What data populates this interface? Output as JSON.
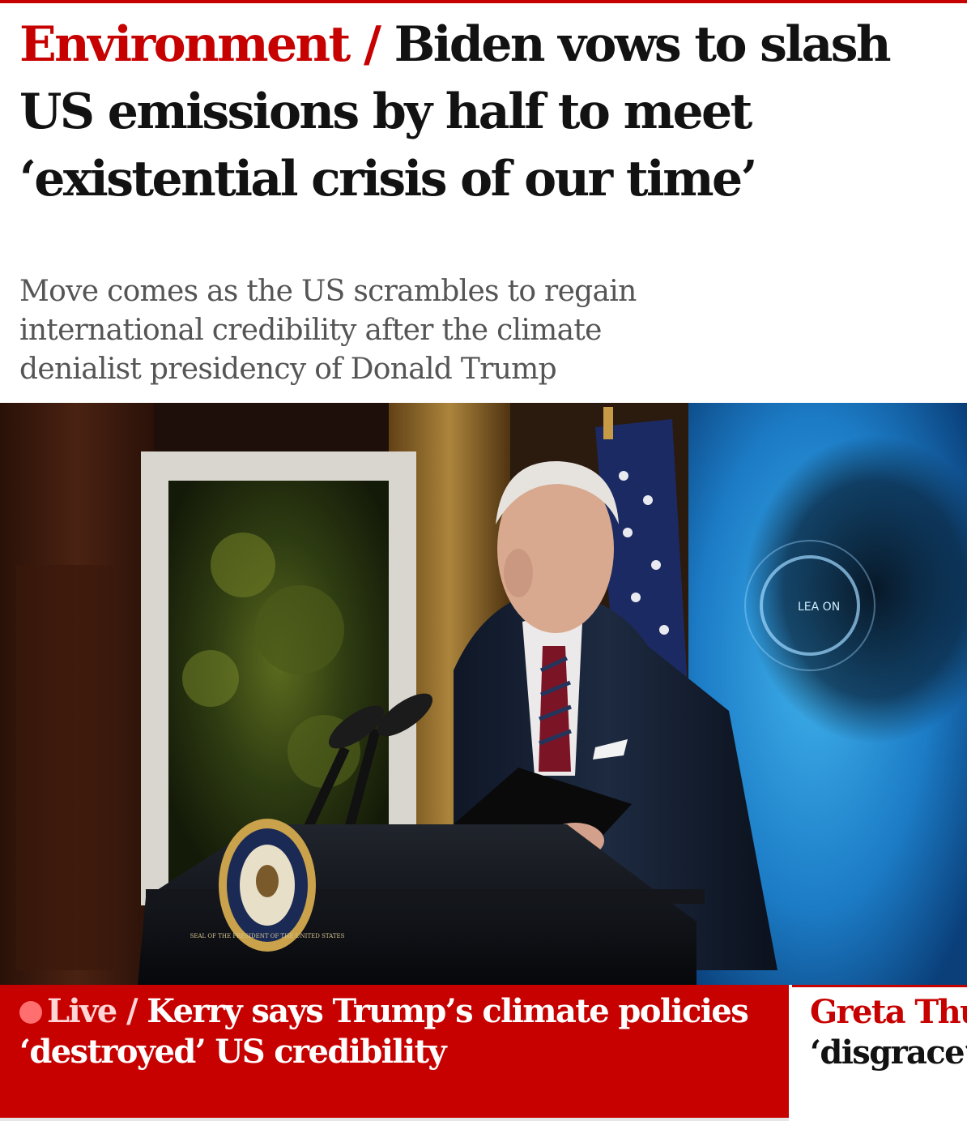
{
  "headline": {
    "kicker": "Environment",
    "separator": "/",
    "title": "Biden vows to slash US emissions by half to meet ‘existential crisis of our time’"
  },
  "standfirst": "Move comes as the US scrambles to regain international credibility after the climate denialist presidency of Donald Trump",
  "hero_image": {
    "screen_text": "LEA ON",
    "seal_text": "SEAL OF THE PRESIDENT OF THE UNITED STATES"
  },
  "related": [
    {
      "live_label": "Live",
      "separator": "/",
      "title": "Kerry says Trump’s climate policies ‘destroyed’ US credibility"
    },
    {
      "title_line1": "Greta Thu",
      "title_line2": "‘disgrace’,"
    }
  ],
  "colors": {
    "accent": "#c70000",
    "headline_text": "#121212",
    "standfirst_text": "#555555"
  }
}
